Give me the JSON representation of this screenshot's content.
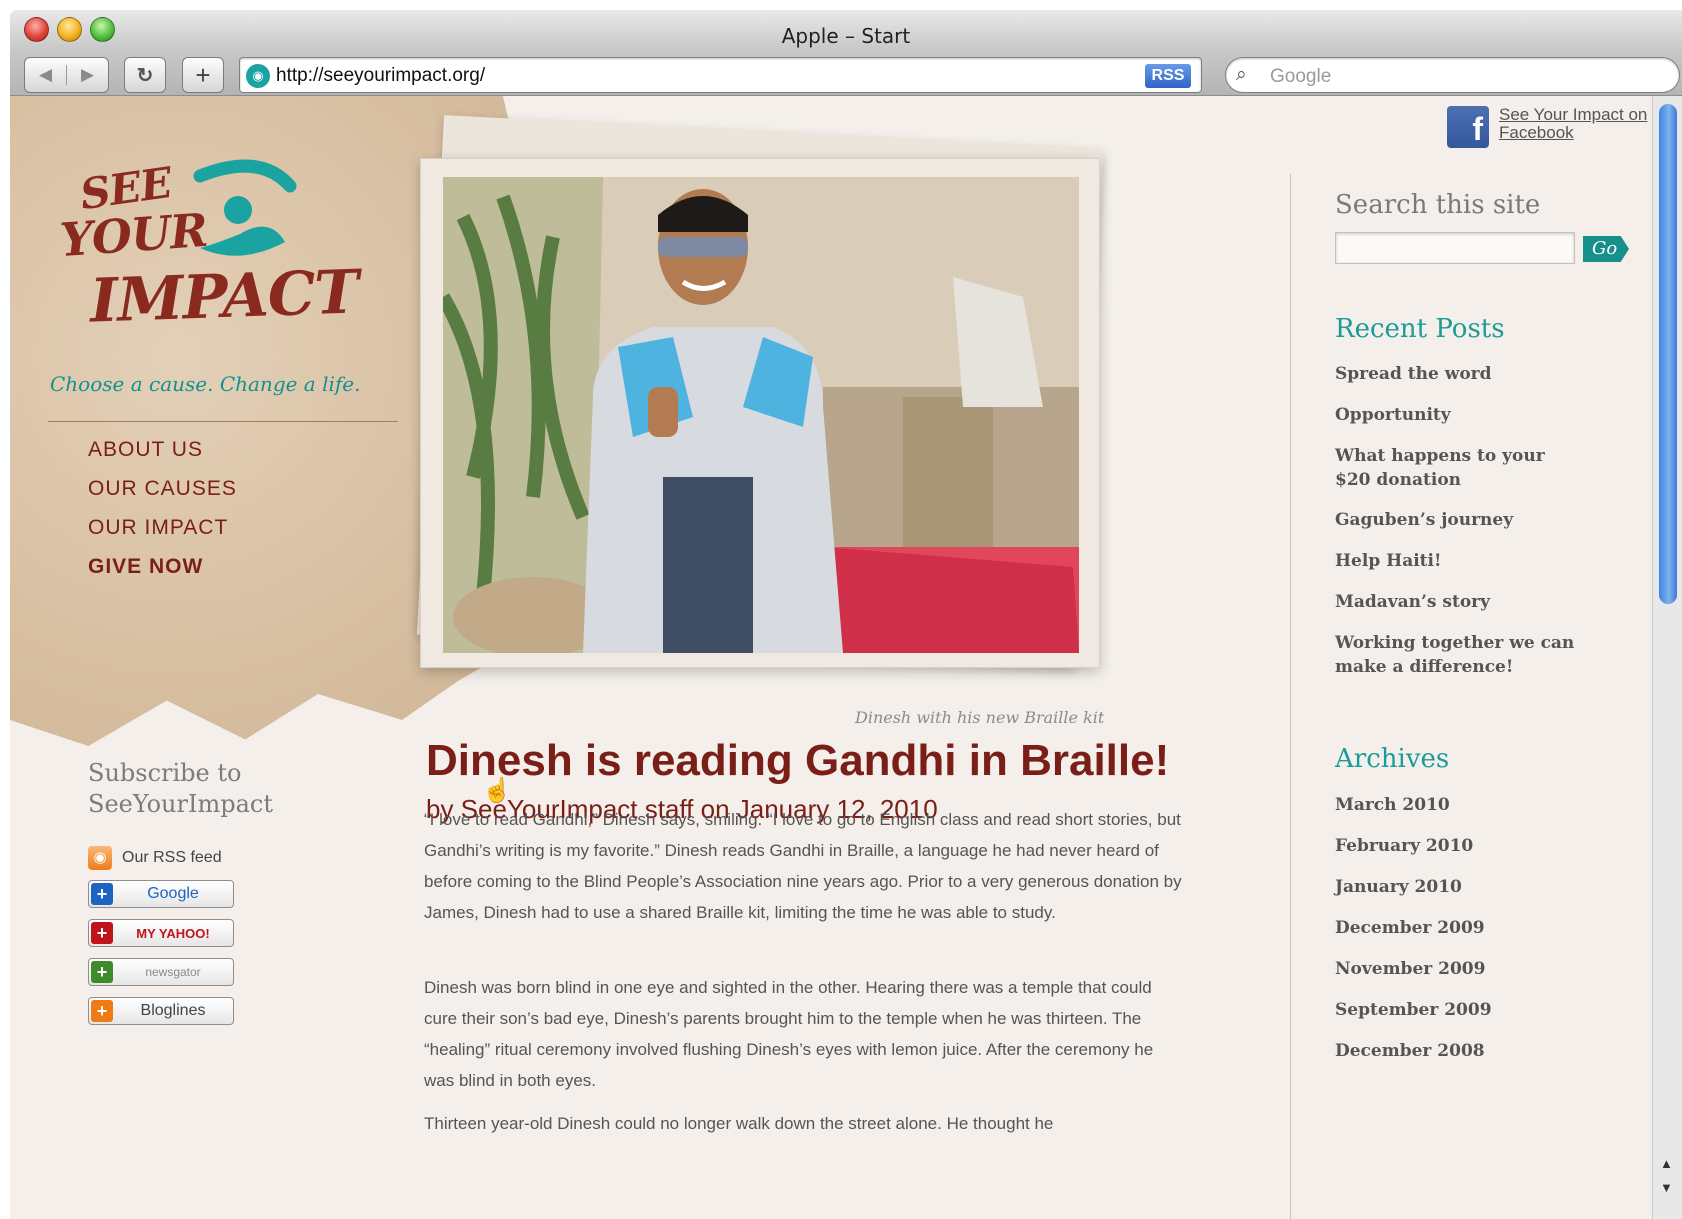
{
  "browser": {
    "window_title": "Apple – Start",
    "back_glyph": "◀",
    "forward_glyph": "▶",
    "reload_glyph": "↻",
    "add_glyph": "+",
    "url": "http://seeyourimpact.org/",
    "rss_badge": "RSS",
    "search_placeholder": "Google",
    "search_glyph": "⌕"
  },
  "site": {
    "logo": {
      "line1": "SEE",
      "line2": "YOUR",
      "line3": "IMPACT"
    },
    "tagline": "Choose a cause. Change a life.",
    "nav": [
      "ABOUT US",
      "OUR CAUSES",
      "OUR IMPACT",
      "GIVE NOW"
    ],
    "facebook": {
      "glyph": "f",
      "link": "See Your Impact on Facebook"
    }
  },
  "subscribe": {
    "title": "Subscribe to SeeYourImpact",
    "rss_glyph": "◉",
    "rss_label": "Our RSS feed",
    "buttons": [
      {
        "label": "Google",
        "color": "#1d63c2"
      },
      {
        "label": "MY YAHOO!",
        "color": "#c0141c"
      },
      {
        "label": "newsgator",
        "color": "#3f8a2a"
      },
      {
        "label": "Bloglines",
        "color": "#f07a14"
      }
    ]
  },
  "photo": {
    "caption": "Dinesh with his new Braille kit"
  },
  "post": {
    "title": "Dinesh is reading Gandhi in Braille!",
    "byline": "by SeeYourImpact staff on January 12, 2010",
    "paragraphs": [
      "“I love to read Gandhi,” Dinesh says, smiling. “I love to go to English class and read short stories, but Gandhi’s writing is my favorite.” Dinesh reads Gandhi in Braille, a language he had never heard of before coming to the Blind People’s Association nine years ago. Prior to a very generous donation by James, Dinesh had to use a shared Braille kit, limiting the time he was able to study.",
      "Dinesh was born blind in one eye and sighted in the other. Hearing there was a temple that could cure their son’s bad eye, Dinesh’s parents brought him to the temple when he was thirteen. The “healing” ritual ceremony involved flushing Dinesh’s eyes with lemon juice. After the ceremony he was blind in both eyes.",
      "Thirteen year-old Dinesh could no longer walk down the street alone. He thought he"
    ]
  },
  "sidebar": {
    "search_title": "Search this site",
    "go_label": "Go",
    "recent_title": "Recent Posts",
    "recent_posts": [
      "Spread the word",
      "Opportunity",
      "What happens to your $20 donation",
      "Gaguben’s journey",
      "Help Haiti!",
      "Madavan’s story",
      "Working together we can make a difference!"
    ],
    "archives_title": "Archives",
    "archives": [
      "March 2010",
      "February 2010",
      "January 2010",
      "December 2009",
      "November 2009",
      "September 2009",
      "December 2008"
    ]
  },
  "colors": {
    "brand_red": "#7a1f17",
    "brand_teal": "#1a9c98",
    "body_text": "#555555"
  },
  "icons": [
    "close-icon",
    "minimize-icon",
    "zoom-icon",
    "back-icon",
    "forward-icon",
    "reload-icon",
    "add-bookmark-icon",
    "site-favicon",
    "rss-icon",
    "search-icon",
    "facebook-icon",
    "feed-icon",
    "plus-icon",
    "pointer-cursor-icon"
  ]
}
